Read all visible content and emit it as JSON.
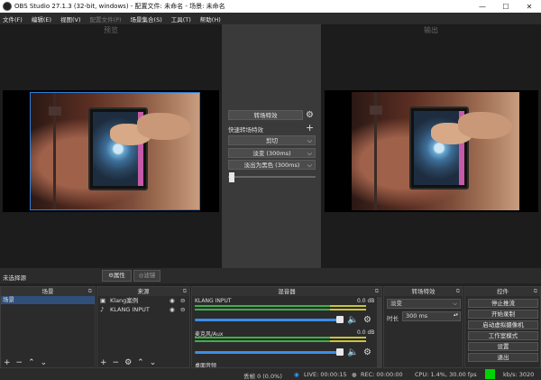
{
  "window": {
    "title": "OBS Studio 27.1.3 (32-bit, windows) - 配置文件: 未命名 - 场景: 未命名",
    "minimize": "—",
    "maximize": "☐",
    "close": "✕"
  },
  "menu": [
    "文件(F)",
    "编辑(E)",
    "视图(V)",
    "配置文件(P)",
    "场景集合(S)",
    "工具(T)",
    "帮助(H)"
  ],
  "panels": {
    "preview_label": "预览",
    "output_label": "输出"
  },
  "transition_controls": {
    "transition_button": "转场特效",
    "quick_transitions_label": "快速转场特效",
    "items": [
      {
        "label": "剪切"
      },
      {
        "label": "淡变 (300ms)"
      },
      {
        "label": "淡出为黑色 (300ms)"
      }
    ]
  },
  "source_toolbar": {
    "no_source": "未选择源",
    "properties": "属性",
    "filters": "滤镜"
  },
  "scenes": {
    "title": "场景",
    "items": [
      "场景"
    ]
  },
  "sources": {
    "title": "来源",
    "items": [
      "Klang案例",
      "KLANG INPUT"
    ]
  },
  "mixer": {
    "title": "混音器",
    "channels": [
      {
        "name": "KLANG INPUT",
        "db": "0.0 dB"
      },
      {
        "name": "麦克风/Aux",
        "db": "0.0 dB"
      },
      {
        "name": "桌面音频",
        "db": ""
      }
    ]
  },
  "transitions_dock": {
    "title": "转场特效",
    "selected": "淡变",
    "duration_label": "时长",
    "duration_value": "300 ms"
  },
  "controls": {
    "title": "控件",
    "buttons": [
      "停止推流",
      "开始录制",
      "启动虚拟摄像机",
      "工作室模式",
      "设置",
      "退出"
    ]
  },
  "status": {
    "dropped": "丢帧 0 (0.0%)",
    "live": "LIVE: 00:00:15",
    "rec": "REC: 00:00:00",
    "cpu": "CPU: 1.4%, 30.00 fps",
    "kbps": "kb/s: 3020"
  },
  "colors": {
    "selection": "#2f4f79",
    "slider": "#3a8ee6",
    "preview_border": "#2f7fdc",
    "meter_green": "#3fae4b",
    "meter_yellow": "#c8c43a",
    "status_green": "#00d400"
  }
}
